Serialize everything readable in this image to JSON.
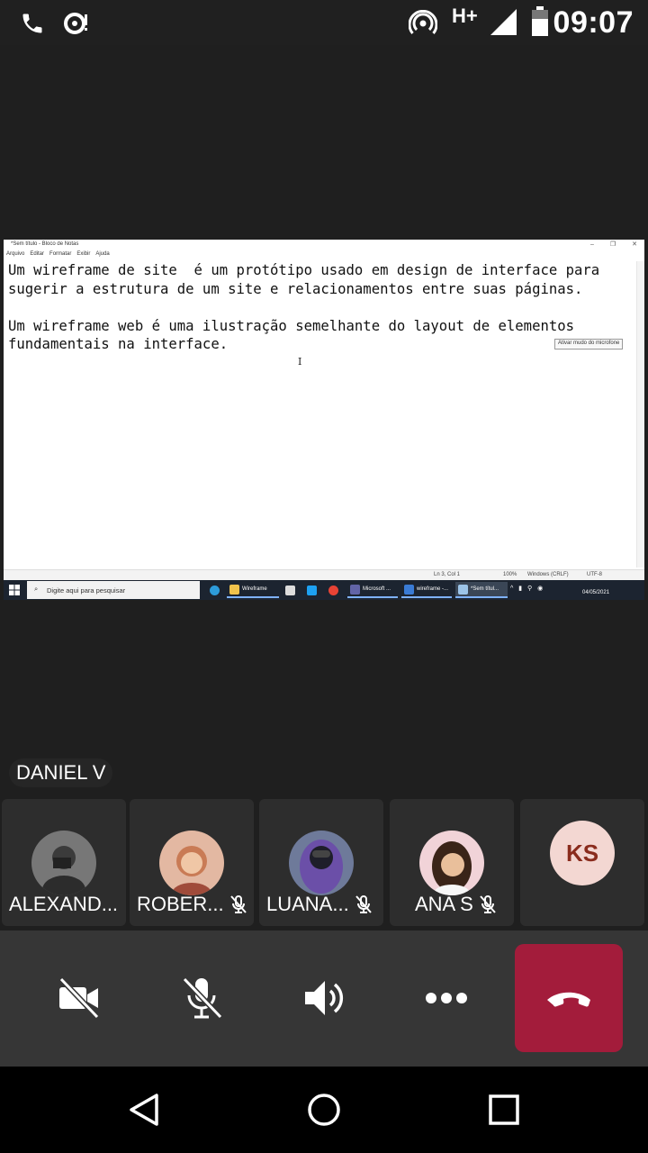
{
  "status_bar": {
    "time": "09:07",
    "network_type": "H+",
    "icons": [
      "phone-icon",
      "sync-icon",
      "hotspot-icon",
      "signal-icon",
      "battery-icon"
    ]
  },
  "shared_screen": {
    "window_title": "*Sem título - Bloco de Notas",
    "menu": [
      "Arquivo",
      "Editar",
      "Formatar",
      "Exibir",
      "Ajuda"
    ],
    "lines": [
      "Um wireframe de site  é um protótipo usado em design de interface para",
      "sugerir a estrutura de um site e relacionamentos entre suas páginas.",
      "",
      "Um wireframe web é uma ilustração semelhante do layout de elementos",
      "fundamentais na interface."
    ],
    "status": {
      "position": "Ln 3, Col 1",
      "zoom": "100%",
      "line_ending": "Windows (CRLF)",
      "encoding": "UTF-8"
    },
    "taskbar": {
      "search_placeholder": "Digite aqui para pesquisar",
      "apps": [
        "Wireframe",
        "Microsoft ...",
        "wireframe -...",
        "*Sem títul..."
      ],
      "tooltip": "Ativar mudo do microfone",
      "date": "04/05/2021"
    }
  },
  "active_speaker": "DANIEL V",
  "participants": [
    {
      "name": "ALEXAND...",
      "muted": false
    },
    {
      "name": "ROBER...",
      "muted": true
    },
    {
      "name": "LUANA...",
      "muted": true
    },
    {
      "name": "ANA S",
      "muted": true
    },
    {
      "initials": "KS"
    }
  ],
  "colors": {
    "hangup": "#a31c3b",
    "initials_bg": "#f3d7d2",
    "tile_bg": "#2d2d2d",
    "controls_bg": "#363636"
  }
}
